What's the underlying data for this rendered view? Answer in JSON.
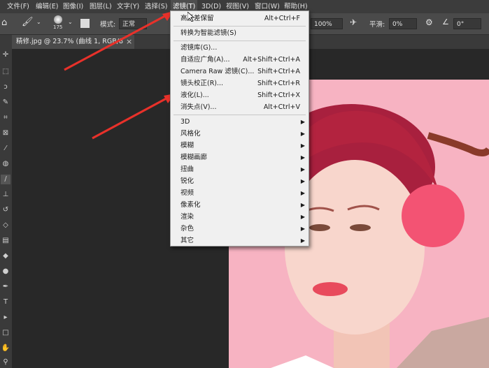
{
  "menubar": [
    "文件(F)",
    "编辑(E)",
    "图像(I)",
    "图层(L)",
    "文字(Y)",
    "选择(S)",
    "滤镜(T)",
    "3D(D)",
    "视图(V)",
    "窗口(W)",
    "帮助(H)"
  ],
  "options": {
    "brush_size": "175",
    "mode_label": "模式:",
    "mode_value": "正常",
    "flow_value": "100%",
    "smooth_label": "平滑:",
    "smooth_value": "0%",
    "angle_value": "0°"
  },
  "doc_tab": {
    "title": "精修.jpg @ 23.7% (曲线 1, RGB/8",
    "close": "×"
  },
  "filter_menu": {
    "items": [
      {
        "label": "高反差保留",
        "shortcut": "Alt+Ctrl+F"
      },
      {
        "label": "转换为智能滤镜(S)",
        "shortcut": ""
      },
      {
        "label": "滤镜库(G)...",
        "shortcut": ""
      },
      {
        "label": "自适应广角(A)...",
        "shortcut": "Alt+Shift+Ctrl+A"
      },
      {
        "label": "Camera Raw 滤镜(C)...",
        "shortcut": "Shift+Ctrl+A"
      },
      {
        "label": "镜头校正(R)...",
        "shortcut": "Shift+Ctrl+R"
      },
      {
        "label": "液化(L)...",
        "shortcut": "Shift+Ctrl+X"
      },
      {
        "label": "消失点(V)...",
        "shortcut": "Alt+Ctrl+V"
      },
      {
        "label": "3D",
        "shortcut": ""
      },
      {
        "label": "风格化",
        "shortcut": ""
      },
      {
        "label": "模糊",
        "shortcut": ""
      },
      {
        "label": "模糊画廊",
        "shortcut": ""
      },
      {
        "label": "扭曲",
        "shortcut": ""
      },
      {
        "label": "锐化",
        "shortcut": ""
      },
      {
        "label": "视频",
        "shortcut": ""
      },
      {
        "label": "像素化",
        "shortcut": ""
      },
      {
        "label": "渲染",
        "shortcut": ""
      },
      {
        "label": "杂色",
        "shortcut": ""
      },
      {
        "label": "其它",
        "shortcut": ""
      }
    ]
  },
  "colors": {
    "menubar_bg": "#3c3c3c",
    "canvas_bg": "#282828",
    "photo_bg": "#f7b3c2",
    "hair": "#a8203e",
    "arrow": "#e8312a"
  }
}
